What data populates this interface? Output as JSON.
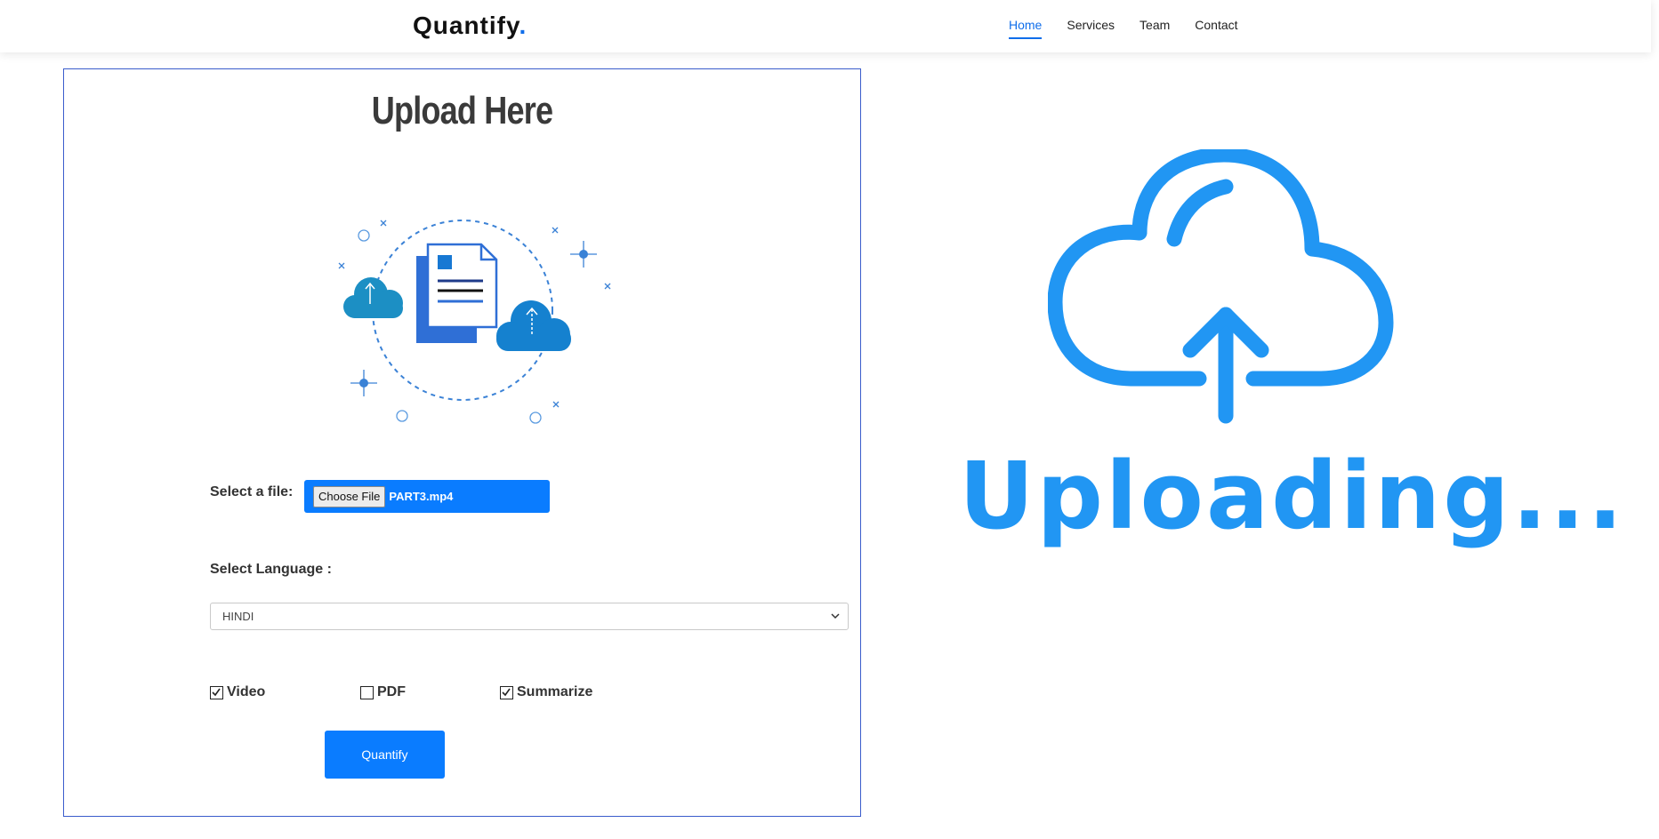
{
  "header": {
    "logo_text": "Quantify",
    "logo_dot": ".",
    "nav": [
      {
        "label": "Home",
        "active": true
      },
      {
        "label": "Services",
        "active": false
      },
      {
        "label": "Team",
        "active": false
      },
      {
        "label": "Contact",
        "active": false
      }
    ]
  },
  "upload_panel": {
    "title": "Upload Here",
    "file_label": "Select a file:",
    "choose_file_label": "Choose File",
    "file_name": "PART3.mp4",
    "language_label": "Select Language :",
    "language_selected": "HINDI",
    "options": [
      {
        "label": "Video",
        "checked": true
      },
      {
        "label": "PDF",
        "checked": false
      },
      {
        "label": "Summarize",
        "checked": true
      }
    ],
    "submit_label": "Quantify"
  },
  "uploading_graphic": {
    "text": "Uploading..."
  },
  "colors": {
    "brand_blue": "#106eea",
    "button_blue": "#0a7cff",
    "graphic_blue": "#2196f3",
    "panel_border": "#3a5ccc"
  },
  "icons": [
    "cloud-upload-illustration",
    "document-icon",
    "cloud-upload-icon",
    "chevron-down-icon",
    "checkmark-icon"
  ]
}
